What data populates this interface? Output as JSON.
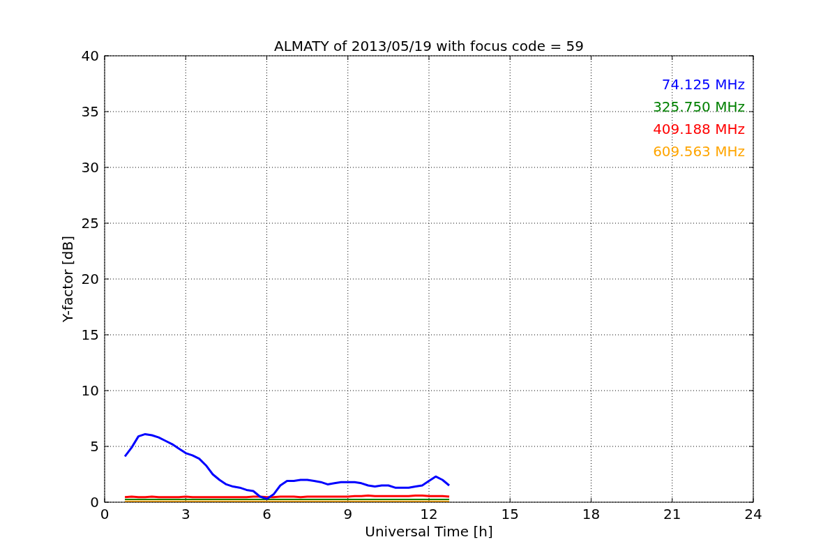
{
  "figure": {
    "chart_data": {
      "type": "line",
      "title": "ALMATY of 2013/05/19 with focus code = 59",
      "xlabel": "Universal Time [h]",
      "ylabel": "Y-factor [dB]",
      "grid": true,
      "x": [
        0.75,
        1.0,
        1.25,
        1.5,
        1.75,
        2.0,
        2.25,
        2.5,
        2.75,
        3.0,
        3.25,
        3.5,
        3.75,
        4.0,
        4.25,
        4.5,
        4.75,
        5.0,
        5.25,
        5.5,
        5.75,
        6.0,
        6.25,
        6.5,
        6.75,
        7.0,
        7.25,
        7.5,
        7.75,
        8.0,
        8.25,
        8.5,
        8.75,
        9.0,
        9.25,
        9.5,
        9.75,
        10.0,
        10.25,
        10.5,
        10.75,
        11.0,
        11.25,
        11.5,
        11.75,
        12.0,
        12.25,
        12.5,
        12.75
      ],
      "series": [
        {
          "name": "74.125 MHz",
          "color": "#0000ff",
          "values": [
            4.1,
            4.9,
            5.9,
            6.1,
            6.0,
            5.8,
            5.5,
            5.2,
            4.8,
            4.4,
            4.2,
            3.9,
            3.3,
            2.5,
            2.0,
            1.6,
            1.4,
            1.3,
            1.1,
            1.0,
            0.5,
            0.3,
            0.7,
            1.5,
            1.9,
            1.9,
            2.0,
            2.0,
            1.9,
            1.8,
            1.6,
            1.7,
            1.8,
            1.8,
            1.8,
            1.7,
            1.5,
            1.4,
            1.5,
            1.5,
            1.3,
            1.3,
            1.3,
            1.4,
            1.5,
            1.9,
            2.3,
            2.0,
            1.5
          ]
        },
        {
          "name": "325.750 MHz",
          "color": "#008000",
          "values": [
            0.25,
            0.25,
            0.25,
            0.25,
            0.25,
            0.25,
            0.25,
            0.25,
            0.25,
            0.25,
            0.25,
            0.25,
            0.25,
            0.25,
            0.25,
            0.25,
            0.25,
            0.25,
            0.25,
            0.25,
            0.25,
            0.25,
            0.25,
            0.25,
            0.25,
            0.25,
            0.25,
            0.25,
            0.25,
            0.25,
            0.25,
            0.25,
            0.25,
            0.25,
            0.25,
            0.25,
            0.25,
            0.25,
            0.25,
            0.25,
            0.25,
            0.25,
            0.25,
            0.25,
            0.25,
            0.25,
            0.25,
            0.25,
            0.25
          ]
        },
        {
          "name": "409.188 MHz",
          "color": "#ff0000",
          "values": [
            0.45,
            0.5,
            0.45,
            0.45,
            0.5,
            0.45,
            0.45,
            0.45,
            0.45,
            0.5,
            0.45,
            0.45,
            0.45,
            0.45,
            0.45,
            0.45,
            0.45,
            0.45,
            0.45,
            0.5,
            0.5,
            0.45,
            0.45,
            0.5,
            0.5,
            0.5,
            0.45,
            0.5,
            0.5,
            0.5,
            0.5,
            0.5,
            0.5,
            0.5,
            0.55,
            0.55,
            0.6,
            0.55,
            0.55,
            0.55,
            0.55,
            0.55,
            0.55,
            0.6,
            0.6,
            0.55,
            0.55,
            0.55,
            0.5
          ]
        },
        {
          "name": "609.563 MHz",
          "color": "#ffa500",
          "values": [
            0.08,
            0.08,
            0.08,
            0.08,
            0.08,
            0.08,
            0.08,
            0.08,
            0.08,
            0.08,
            0.08,
            0.08,
            0.08,
            0.08,
            0.08,
            0.08,
            0.08,
            0.08,
            0.08,
            0.08,
            0.08,
            0.08,
            0.08,
            0.08,
            0.08,
            0.08,
            0.08,
            0.08,
            0.08,
            0.08,
            0.08,
            0.08,
            0.08,
            0.08,
            0.08,
            0.08,
            0.08,
            0.08,
            0.08,
            0.08,
            0.08,
            0.08,
            0.08,
            0.08,
            0.08,
            0.08,
            0.08,
            0.08,
            0.08
          ]
        }
      ],
      "xlim": [
        0,
        24
      ],
      "ylim": [
        0,
        40
      ],
      "xticks": [
        0,
        3,
        6,
        9,
        12,
        15,
        18,
        21,
        24
      ],
      "yticks": [
        0,
        5,
        10,
        15,
        20,
        25,
        30,
        35,
        40
      ]
    }
  }
}
